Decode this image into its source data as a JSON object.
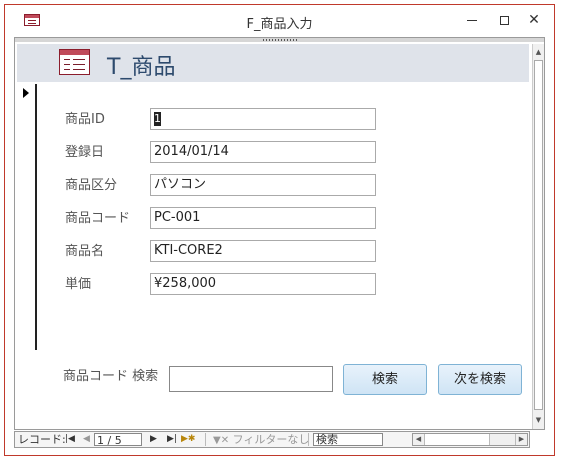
{
  "window": {
    "title": "F_商品入力",
    "min_icon": "minimize-icon",
    "max_icon": "maximize-icon",
    "close_symbol": "✕"
  },
  "form": {
    "header_title": "T_商品",
    "fields": [
      {
        "label": "商品ID",
        "value": "1"
      },
      {
        "label": "登録日",
        "value": "2014/01/14"
      },
      {
        "label": "商品区分",
        "value": "パソコン"
      },
      {
        "label": "商品コード",
        "value": "PC-001"
      },
      {
        "label": "商品名",
        "value": "KTI-CORE2"
      },
      {
        "label": "単価",
        "value": "¥258,000"
      }
    ],
    "search": {
      "label": "商品コード 検索",
      "value": "",
      "search_button": "検索",
      "next_button": "次を検索"
    }
  },
  "navigation": {
    "record_label": "レコード:",
    "position": "1 / 5",
    "filter_label": "フィルターなし",
    "search_placeholder": "検索",
    "first_icon": "first-record-icon",
    "prev_icon": "prev-record-icon",
    "next_icon": "next-record-icon",
    "last_icon": "last-record-icon",
    "new_icon": "new-record-icon"
  },
  "colors": {
    "window_border": "#c0392b",
    "header_bg": "#dfe3ea",
    "header_text": "#2d4a6d",
    "button_border": "#7fb3d5"
  }
}
